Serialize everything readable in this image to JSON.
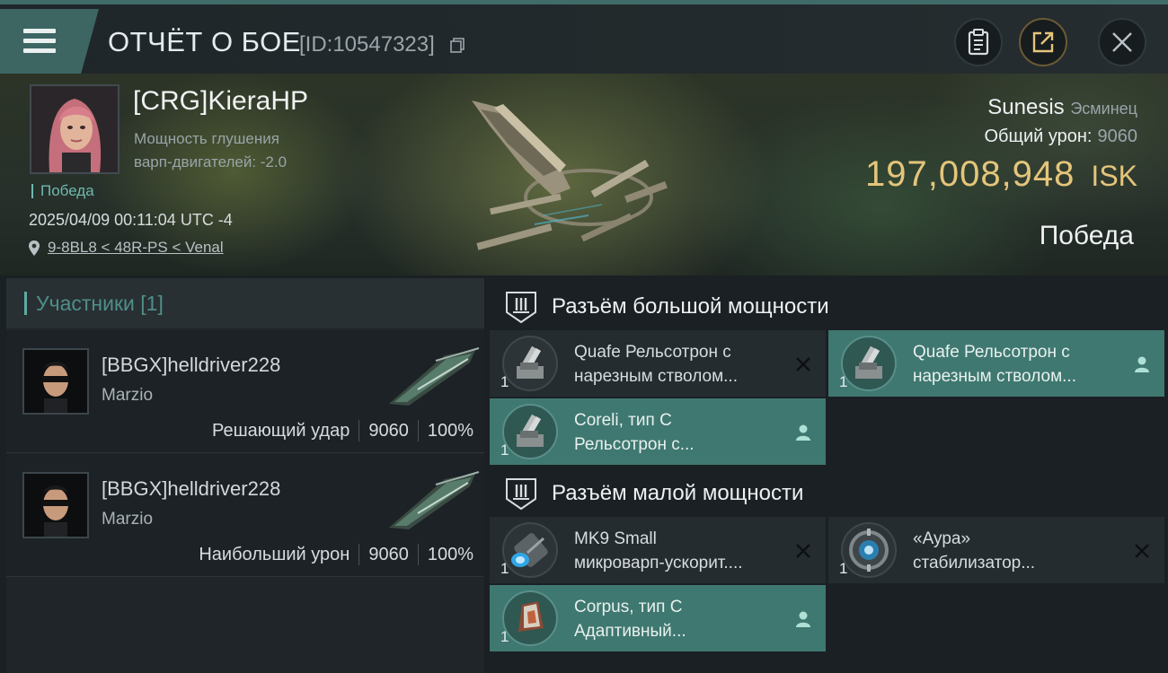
{
  "header": {
    "title": "ОТЧЁТ О БОЕ",
    "report_id": "[ID:10547323]"
  },
  "hero": {
    "pilot_name": "[CRG]KieraHP",
    "pilot_stat_line1": "Мощность глушения",
    "pilot_stat_line2": "варп-двигателей: -2.0",
    "result_tag": "Победа",
    "datetime": "2025/04/09 00:11:04 UTC -4",
    "location": "9-8BL8 < 48R-PS < Venal",
    "ship_name": "Sunesis",
    "ship_class": "Эсминец",
    "damage_label": "Общий урон:",
    "damage_value": "9060",
    "isk_value": "197,008,948",
    "isk_unit": "ISK",
    "verdict": "Победа"
  },
  "participants": {
    "header": "Участники [1]",
    "items": [
      {
        "name": "[BBGX]helldriver228",
        "corp": "Marzio",
        "role": "Решающий удар",
        "damage": "9060",
        "percent": "100%"
      },
      {
        "name": "[BBGX]helldriver228",
        "corp": "Marzio",
        "role": "Наибольший урон",
        "damage": "9060",
        "percent": "100%"
      }
    ]
  },
  "fitting": {
    "high_title": "Разъём большой мощности",
    "low_title": "Разъём малой мощности",
    "high": [
      {
        "qty": "1",
        "line1": "Quafe Рельсотрон с",
        "line2": "нарезным стволом...",
        "status": "destroyed",
        "icon": "railgun-icon"
      },
      {
        "qty": "1",
        "line1": "Quafe Рельсотрон с",
        "line2": "нарезным стволом...",
        "status": "dropped",
        "icon": "railgun-icon"
      },
      {
        "qty": "1",
        "line1": "Coreli, тип C",
        "line2": "Рельсотрон с...",
        "status": "dropped",
        "icon": "railgun-icon"
      }
    ],
    "low": [
      {
        "qty": "1",
        "line1": "MK9 Small",
        "line2": "микроварп-ускорит....",
        "status": "destroyed",
        "icon": "microwarp-icon"
      },
      {
        "qty": "1",
        "line1": "«Аура»",
        "line2": "стабилизатор...",
        "status": "destroyed",
        "icon": "stabilizer-icon"
      },
      {
        "qty": "1",
        "line1": "Corpus, тип C",
        "line2": "Адаптивный...",
        "status": "dropped",
        "icon": "hardener-icon"
      }
    ]
  }
}
